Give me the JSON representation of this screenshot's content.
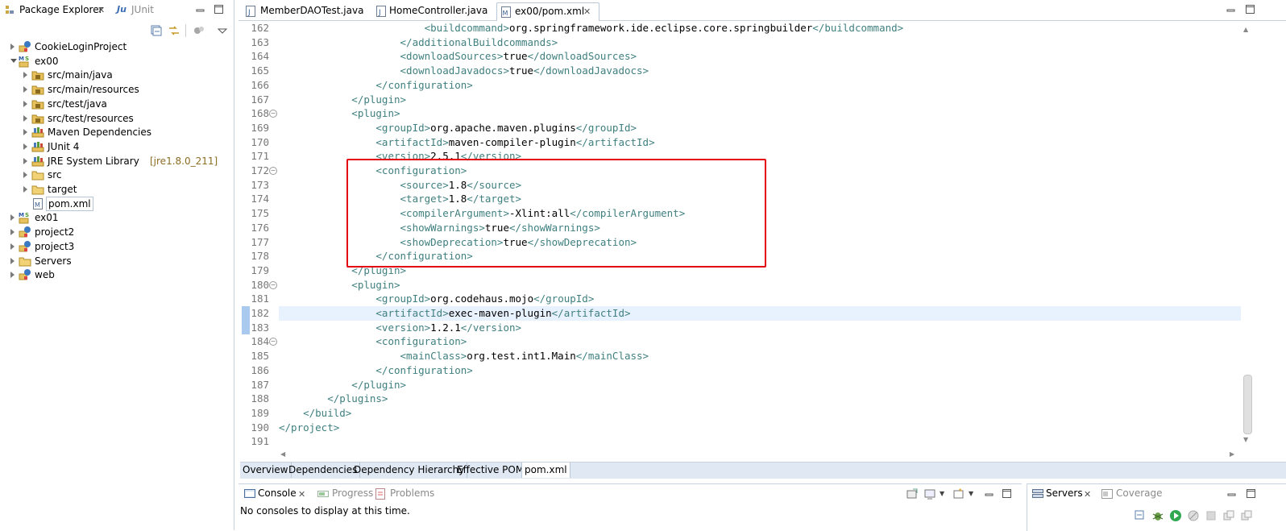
{
  "package_explorer": {
    "tab_title": "Package Explorer",
    "tab_close": "✕",
    "tab2_title": "JUnit",
    "tree": [
      {
        "label": "CookieLoginProject",
        "icon": "web-project-icon",
        "level": 0,
        "expanded": false
      },
      {
        "label": "ex00",
        "icon": "maven-spring-project-icon",
        "level": 0,
        "expanded": true
      },
      {
        "label": "src/main/java",
        "icon": "source-folder-icon",
        "level": 1,
        "expanded": false
      },
      {
        "label": "src/main/resources",
        "icon": "source-folder-icon",
        "level": 1,
        "expanded": false
      },
      {
        "label": "src/test/java",
        "icon": "source-folder-icon",
        "level": 1,
        "expanded": false
      },
      {
        "label": "src/test/resources",
        "icon": "source-folder-icon",
        "level": 1,
        "expanded": false
      },
      {
        "label": "Maven Dependencies",
        "icon": "library-icon",
        "level": 1,
        "expanded": false
      },
      {
        "label": "JUnit 4",
        "icon": "library-icon",
        "level": 1,
        "expanded": false
      },
      {
        "label": "JRE System Library",
        "decoration": "[jre1.8.0_211]",
        "icon": "library-icon",
        "level": 1,
        "expanded": false
      },
      {
        "label": "src",
        "icon": "folder-icon",
        "level": 1,
        "expanded": false
      },
      {
        "label": "target",
        "icon": "folder-icon",
        "level": 1,
        "expanded": false
      },
      {
        "label": "pom.xml",
        "icon": "maven-file-icon",
        "level": 1,
        "expanded": null,
        "selected": true
      },
      {
        "label": "ex01",
        "icon": "maven-spring-project-icon",
        "level": 0,
        "expanded": false
      },
      {
        "label": "project2",
        "icon": "web-project-icon",
        "level": 0,
        "expanded": false
      },
      {
        "label": "project3",
        "icon": "web-project-icon",
        "level": 0,
        "expanded": false
      },
      {
        "label": "Servers",
        "icon": "folder-icon",
        "level": 0,
        "expanded": false
      },
      {
        "label": "web",
        "icon": "web-project-icon",
        "level": 0,
        "expanded": false
      }
    ]
  },
  "editor": {
    "tabs": [
      {
        "label": "MemberDAOTest.java",
        "icon": "java-file-icon",
        "active": false
      },
      {
        "label": "HomeController.java",
        "icon": "java-file-icon",
        "active": false
      },
      {
        "label": "ex00/pom.xml",
        "icon": "maven-file-icon",
        "active": true,
        "close": "✕"
      }
    ],
    "lines": [
      {
        "n": "162",
        "code": [
          [
            "t",
            "                        <buildcommand>"
          ],
          [
            "x",
            "org.springframework.ide.eclipse.core.springbuilder"
          ],
          [
            "t",
            "</buildcommand>"
          ]
        ]
      },
      {
        "n": "163",
        "code": [
          [
            "t",
            "                    </additionalBuildcommands>"
          ]
        ]
      },
      {
        "n": "164",
        "code": [
          [
            "t",
            "                    <downloadSources>"
          ],
          [
            "x",
            "true"
          ],
          [
            "t",
            "</downloadSources>"
          ]
        ]
      },
      {
        "n": "165",
        "code": [
          [
            "t",
            "                    <downloadJavadocs>"
          ],
          [
            "x",
            "true"
          ],
          [
            "t",
            "</downloadJavadocs>"
          ]
        ]
      },
      {
        "n": "166",
        "code": [
          [
            "t",
            "                </configuration>"
          ]
        ]
      },
      {
        "n": "167",
        "code": [
          [
            "t",
            "            </plugin>"
          ]
        ]
      },
      {
        "n": "168",
        "code": [
          [
            "t",
            "            <plugin>"
          ]
        ],
        "fold": true
      },
      {
        "n": "169",
        "code": [
          [
            "t",
            "                <groupId>"
          ],
          [
            "x",
            "org.apache.maven.plugins"
          ],
          [
            "t",
            "</groupId>"
          ]
        ]
      },
      {
        "n": "170",
        "code": [
          [
            "t",
            "                <artifactId>"
          ],
          [
            "x",
            "maven-compiler-plugin"
          ],
          [
            "t",
            "</artifactId>"
          ]
        ]
      },
      {
        "n": "171",
        "code": [
          [
            "t",
            "                <version>"
          ],
          [
            "x",
            "2.5.1"
          ],
          [
            "t",
            "</version>"
          ]
        ]
      },
      {
        "n": "172",
        "code": [
          [
            "t",
            "                <configuration>"
          ]
        ],
        "fold": true
      },
      {
        "n": "173",
        "code": [
          [
            "t",
            "                    <source>"
          ],
          [
            "x",
            "1.8"
          ],
          [
            "t",
            "</source>"
          ]
        ]
      },
      {
        "n": "174",
        "code": [
          [
            "t",
            "                    <target>"
          ],
          [
            "x",
            "1.8"
          ],
          [
            "t",
            "</target>"
          ]
        ]
      },
      {
        "n": "175",
        "code": [
          [
            "t",
            "                    <compilerArgument>"
          ],
          [
            "x",
            "-Xlint:all"
          ],
          [
            "t",
            "</compilerArgument>"
          ]
        ]
      },
      {
        "n": "176",
        "code": [
          [
            "t",
            "                    <showWarnings>"
          ],
          [
            "x",
            "true"
          ],
          [
            "t",
            "</showWarnings>"
          ]
        ]
      },
      {
        "n": "177",
        "code": [
          [
            "t",
            "                    <showDeprecation>"
          ],
          [
            "x",
            "true"
          ],
          [
            "t",
            "</showDeprecation>"
          ]
        ]
      },
      {
        "n": "178",
        "code": [
          [
            "t",
            "                </configuration>"
          ]
        ]
      },
      {
        "n": "179",
        "code": [
          [
            "t",
            "            </plugin>"
          ]
        ]
      },
      {
        "n": "180",
        "code": [
          [
            "t",
            "            <plugin>"
          ]
        ],
        "fold": true
      },
      {
        "n": "181",
        "code": [
          [
            "t",
            "                <groupId>"
          ],
          [
            "x",
            "org.codehaus.mojo"
          ],
          [
            "t",
            "</groupId>"
          ]
        ]
      },
      {
        "n": "182",
        "code": [
          [
            "t",
            "                <artifactId>"
          ],
          [
            "x",
            "exec-maven-plugin"
          ],
          [
            "t",
            "</artifactId>"
          ]
        ],
        "current": true
      },
      {
        "n": "183",
        "code": [
          [
            "t",
            "                <version>"
          ],
          [
            "x",
            "1.2.1"
          ],
          [
            "t",
            "</version>"
          ]
        ]
      },
      {
        "n": "184",
        "code": [
          [
            "t",
            "                <configuration>"
          ]
        ],
        "fold": true
      },
      {
        "n": "185",
        "code": [
          [
            "t",
            "                    <mainClass>"
          ],
          [
            "x",
            "org.test.int1.Main"
          ],
          [
            "t",
            "</mainClass>"
          ]
        ]
      },
      {
        "n": "186",
        "code": [
          [
            "t",
            "                </configuration>"
          ]
        ]
      },
      {
        "n": "187",
        "code": [
          [
            "t",
            "            </plugin>"
          ]
        ]
      },
      {
        "n": "188",
        "code": [
          [
            "t",
            "        </plugins>"
          ]
        ]
      },
      {
        "n": "189",
        "code": [
          [
            "t",
            "    </build>"
          ]
        ]
      },
      {
        "n": "190",
        "code": [
          [
            "t",
            "</project>"
          ]
        ]
      },
      {
        "n": "191",
        "code": []
      }
    ],
    "bottom_tabs": [
      {
        "label": "Overview",
        "active": false
      },
      {
        "label": "Dependencies",
        "active": false
      },
      {
        "label": "Dependency Hierarchy",
        "active": false
      },
      {
        "label": "Effective POM",
        "active": false
      },
      {
        "label": "pom.xml",
        "active": true
      }
    ]
  },
  "console_panel": {
    "tabs": [
      {
        "label": "Console",
        "active": true,
        "close": "✕"
      },
      {
        "label": "Progress",
        "active": false
      },
      {
        "label": "Problems",
        "active": false
      }
    ],
    "message": "No consoles to display at this time."
  },
  "servers_panel": {
    "tabs": [
      {
        "label": "Servers",
        "active": true,
        "close": "✕"
      },
      {
        "label": "Coverage",
        "active": false
      }
    ]
  },
  "colors": {
    "xml_tag": "#3f7f7f",
    "highlight_box": "#e3000f",
    "current_line": "#e8f2fe"
  }
}
